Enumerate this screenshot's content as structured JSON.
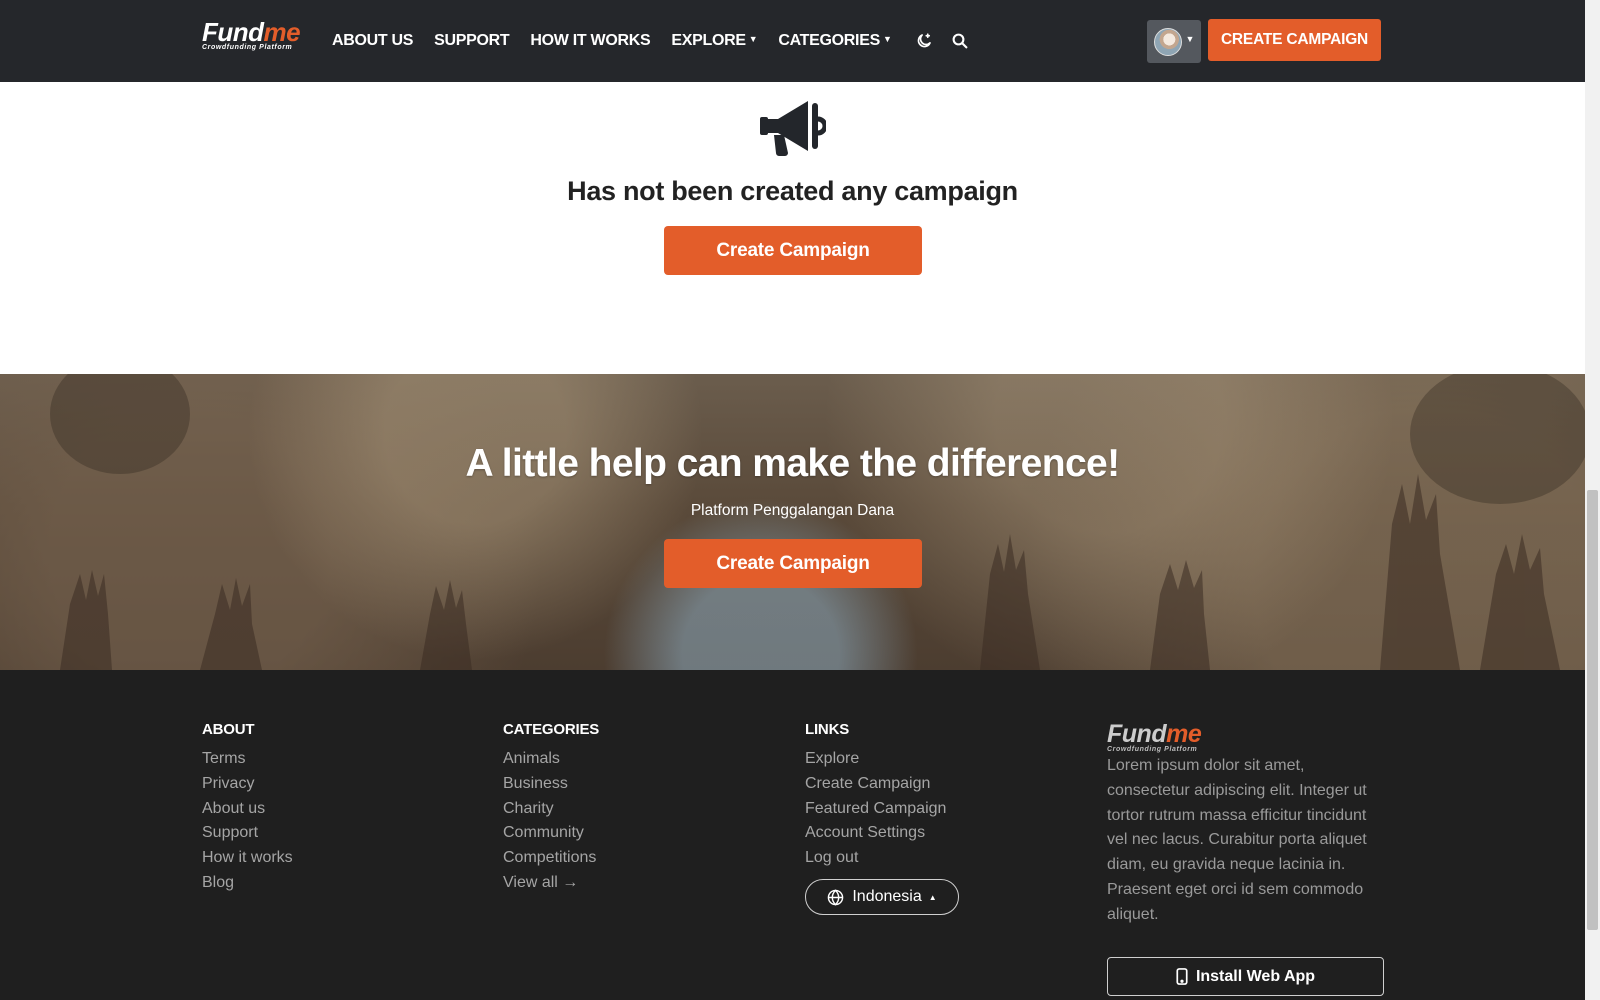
{
  "navbar": {
    "logo": {
      "name": "Fund",
      "accent": "me",
      "tagline": "Crowdfunding Platform"
    },
    "links": {
      "about_us": "ABOUT US",
      "support": "SUPPORT",
      "how_it_works": "HOW IT WORKS",
      "explore": "EXPLORE",
      "categories": "CATEGORIES"
    },
    "icons": [
      "dark-mode-moon-icon",
      "search-icon",
      "chevron-down-icon"
    ],
    "cta_label": "CREATE CAMPAIGN"
  },
  "empty_state": {
    "icon": "megaphone-icon",
    "title": "Has not been created any campaign",
    "button_label": "Create Campaign"
  },
  "hero": {
    "title": "A little help can make the difference!",
    "subtitle": "Platform Penggalangan Dana",
    "button_label": "Create Campaign"
  },
  "footer": {
    "about": {
      "heading": "ABOUT",
      "items": [
        "Terms",
        "Privacy",
        "About us",
        "Support",
        "How it works",
        "Blog"
      ]
    },
    "categories": {
      "heading": "CATEGORIES",
      "items": [
        "Animals",
        "Business",
        "Charity",
        "Community",
        "Competitions"
      ],
      "view_all": "View all"
    },
    "links": {
      "heading": "LINKS",
      "items": [
        "Explore",
        "Create Campaign",
        "Featured Campaign",
        "Account Settings",
        "Log out"
      ]
    },
    "language": {
      "selected": "Indonesia",
      "icon": "globe-icon"
    },
    "brand": {
      "name": "Fund",
      "accent": "me",
      "tagline": "Crowdfunding Platform",
      "description": "Lorem ipsum dolor sit amet, consectetur adipiscing elit. Integer ut tortor rutrum massa efficitur tincidunt vel nec lacus. Curabitur porta aliquet diam, eu gravida neque lacinia in. Praesent eget orci id sem commodo aliquet."
    },
    "install_label": "Install Web App"
  },
  "colors": {
    "accent": "#e35d2a",
    "navbar_bg": "#25272b",
    "footer_bg": "#1f1f1f"
  }
}
